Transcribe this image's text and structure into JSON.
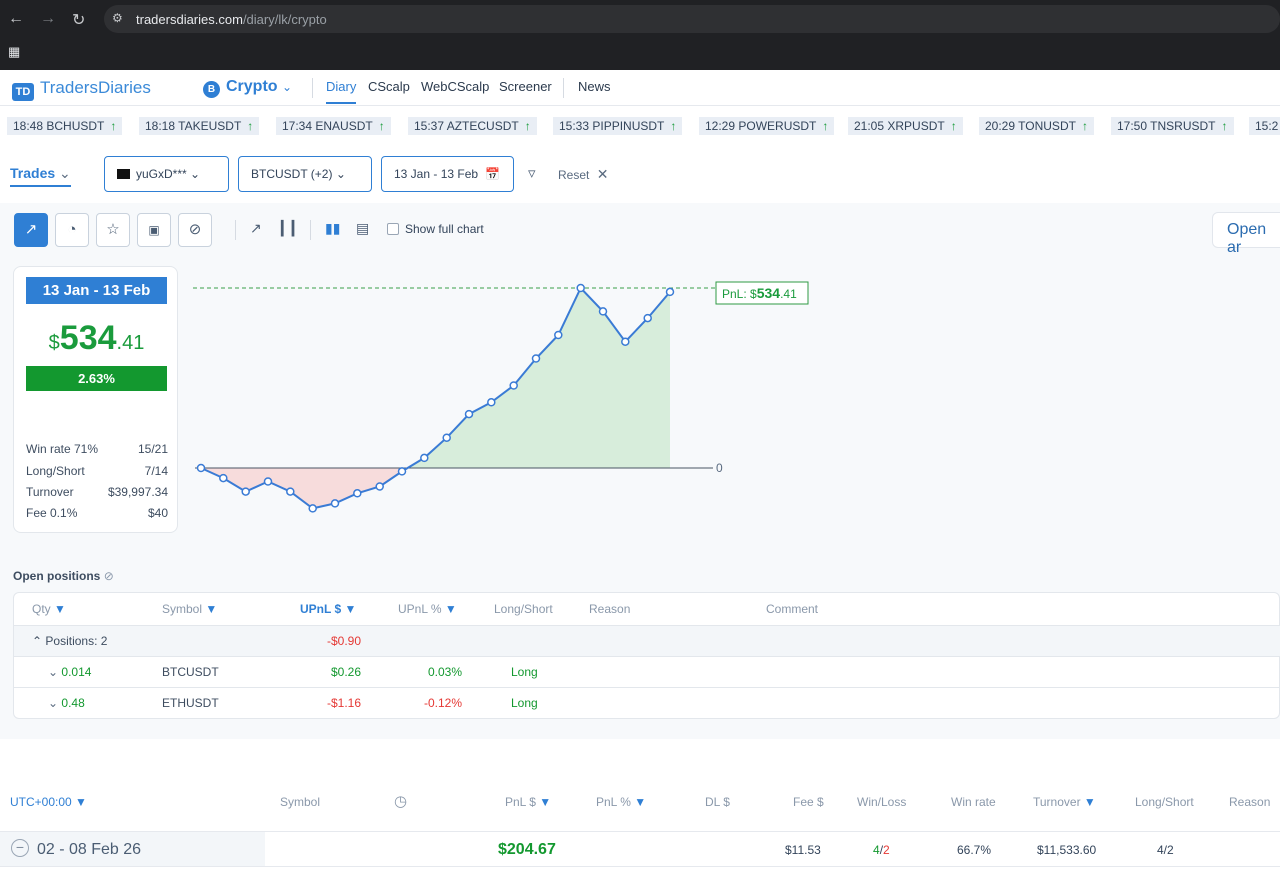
{
  "browser": {
    "url_host": "tradersdiaries.com",
    "url_path": "/diary/lk/crypto"
  },
  "header": {
    "logo_mark": "TD",
    "logo_text": "TradersDiaries",
    "market": "Crypto",
    "menu": [
      "Diary",
      "CScalp",
      "WebCScalp",
      "Screener",
      "News"
    ]
  },
  "ticker": [
    {
      "time": "18:48",
      "symbol": "BCHUSDT"
    },
    {
      "time": "18:18",
      "symbol": "TAKEUSDT"
    },
    {
      "time": "17:34",
      "symbol": "ENAUSDT"
    },
    {
      "time": "15:37",
      "symbol": "AZTECUSDT"
    },
    {
      "time": "15:33",
      "symbol": "PIPPINUSDT"
    },
    {
      "time": "12:29",
      "symbol": "POWERUSDT"
    },
    {
      "time": "21:05",
      "symbol": "XRPUSDT"
    },
    {
      "time": "20:29",
      "symbol": "TONUSDT"
    },
    {
      "time": "17:50",
      "symbol": "TNSRUSDT"
    },
    {
      "time": "15:2",
      "symbol": ""
    }
  ],
  "filters": {
    "tab": "Trades",
    "account": "yuGxD***",
    "symbols": "BTCUSDT  (+2)",
    "date_range": "13 Jan - 13 Feb",
    "reset": "Reset"
  },
  "toolbar": {
    "show_full_chart": "Show full chart",
    "show_full_chart_checked": false,
    "open_button": "Open ar"
  },
  "summary": {
    "date": "13 Jan - 13 Feb",
    "pnl_currency": "$",
    "pnl_int": "534",
    "pnl_dec": ".41",
    "pnl_pct": "2.63%",
    "stats": [
      {
        "label": "Win rate 71%",
        "value": "15/21"
      },
      {
        "label": "Long/Short",
        "value": "7/14"
      },
      {
        "label": "Turnover",
        "value": "$39,997.34"
      },
      {
        "label": "Fee 0.1%",
        "value": "$40"
      }
    ]
  },
  "chart_data": {
    "type": "area",
    "title": "",
    "y_zero_label": "0",
    "pnl_label_prefix": "PnL: $",
    "pnl_label_int": "534",
    "pnl_label_dec": ".41",
    "final_value": 534.41,
    "values": [
      0,
      -30,
      -70,
      -40,
      -70,
      -120,
      -105,
      -75,
      -55,
      -10,
      30,
      90,
      160,
      195,
      245,
      325,
      395,
      534.41,
      465,
      375,
      445,
      523
    ],
    "colors": {
      "line": "#3a7bd5",
      "positive_fill": "#d7eddb",
      "negative_fill": "#f7dcdc",
      "dashed": "#3aa04a"
    }
  },
  "positions": {
    "title": "Open positions",
    "headers": [
      "Qty",
      "Symbol",
      "UPnL $",
      "UPnL %",
      "Long/Short",
      "Reason",
      "Comment"
    ],
    "group": {
      "label": "Positions: 2",
      "upnl": "-$0.90"
    },
    "rows": [
      {
        "qty": "0.014",
        "symbol": "BTCUSDT",
        "upnl": "$0.26",
        "upnl_pct": "0.03%",
        "side": "Long",
        "sign": "pos"
      },
      {
        "qty": "0.48",
        "symbol": "ETHUSDT",
        "upnl": "-$1.16",
        "upnl_pct": "-0.12%",
        "side": "Long",
        "sign": "neg"
      }
    ]
  },
  "trades_table": {
    "headers": [
      "UTC+00:00",
      "Symbol",
      "PnL $",
      "PnL %",
      "DL $",
      "Fee $",
      "Win/Loss",
      "Win rate",
      "Turnover",
      "Long/Short",
      "Reason"
    ],
    "row": {
      "period": "02 - 08 Feb 26",
      "pnl": "$204.67",
      "fee": "$11.53",
      "wins": "4",
      "losses": "2",
      "win_rate": "66.7%",
      "turnover": "$11,533.60",
      "long_short": "4/2"
    }
  }
}
